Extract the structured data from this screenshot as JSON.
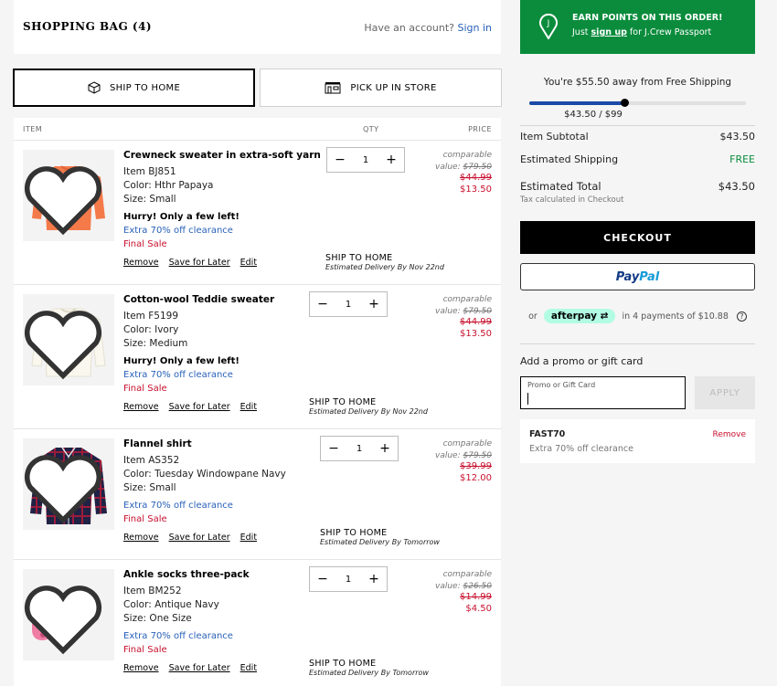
{
  "header": {
    "title": "SHOPPING BAG (4)",
    "account_prompt": "Have an account?",
    "sign_in": "Sign in"
  },
  "fulfillment": {
    "ship_to_home": "SHIP TO HOME",
    "pick_up_in_store": "PICK UP IN STORE",
    "selected": "ship_to_home"
  },
  "columns": {
    "item": "ITEM",
    "qty": "QTY",
    "price": "PRICE"
  },
  "items": [
    {
      "name": "Crewneck sweater in extra-soft yarn",
      "item_no": "Item BJ851",
      "color": "Color: Hthr Papaya",
      "size": "Size: Small",
      "hurry": "Hurry! Only a few left!",
      "promo": "Extra 70% off clearance",
      "final_sale": "Final Sale",
      "qty": "1",
      "comparable_label": "comparable",
      "comparable_value_label": "value:",
      "comparable_value": "$79.50",
      "was_price": "$44.99",
      "price": "$13.50",
      "ship_method": "SHIP TO HOME",
      "delivery": "Estimated Delivery By Nov 22nd",
      "image_color": "#f47a4a"
    },
    {
      "name": "Cotton-wool Teddie sweater",
      "item_no": "Item F5199",
      "color": "Color: Ivory",
      "size": "Size: Medium",
      "hurry": "Hurry! Only a few left!",
      "promo": "Extra 70% off clearance",
      "final_sale": "Final Sale",
      "qty": "1",
      "comparable_label": "comparable",
      "comparable_value_label": "value:",
      "comparable_value": "$79.50",
      "was_price": "$44.99",
      "price": "$13.50",
      "ship_method": "SHIP TO HOME",
      "delivery": "Estimated Delivery By Nov 22nd",
      "image_color": "#f7f4ea"
    },
    {
      "name": "Flannel shirt",
      "item_no": "Item AS352",
      "color": "Color: Tuesday Windowpane Navy",
      "size": "Size: Small",
      "promo": "Extra 70% off clearance",
      "final_sale": "Final Sale",
      "qty": "1",
      "comparable_label": "comparable",
      "comparable_value_label": "value:",
      "comparable_value": "$79.50",
      "was_price": "$39.99",
      "price": "$12.00",
      "ship_method": "SHIP TO HOME",
      "delivery": "Estimated Delivery By Tomorrow",
      "image_color": "#1f2245"
    },
    {
      "name": "Ankle socks three-pack",
      "item_no": "Item BM252",
      "color": "Color: Antique Navy",
      "size": "Size: One Size",
      "promo": "Extra 70% off clearance",
      "final_sale": "Final Sale",
      "qty": "1",
      "comparable_label": "comparable",
      "comparable_value_label": "value:",
      "comparable_value": "$26.50",
      "was_price": "$14.99",
      "price": "$4.50",
      "ship_method": "SHIP TO HOME",
      "delivery": "Estimated Delivery By Tomorrow",
      "image_color": "#ef7ca3"
    }
  ],
  "item_actions": {
    "remove": "Remove",
    "save_for_later": "Save for Later",
    "edit": "Edit"
  },
  "rewards": {
    "title": "EARN POINTS ON THIS ORDER!",
    "just": "Just",
    "sign_up": "sign up",
    "suffix": "for J.Crew Passport"
  },
  "free_shipping": {
    "message": "You're $55.50 away from Free Shipping",
    "progress_label": "$43.50 / $99",
    "progress": 0.44
  },
  "summary": {
    "subtotal_label": "Item Subtotal",
    "subtotal": "$43.50",
    "shipping_label": "Estimated Shipping",
    "shipping": "FREE",
    "total_label": "Estimated Total",
    "total": "$43.50",
    "tax_note": "Tax calculated in Checkout"
  },
  "checkout": {
    "label": "CHECKOUT"
  },
  "paypal": {
    "pay": "Pay",
    "pal": "Pal"
  },
  "afterpay": {
    "or": "or",
    "brand": "afterpay",
    "text": "in 4 payments of $10.88",
    "help": "?"
  },
  "promo": {
    "title": "Add a promo or gift card",
    "placeholder": "Promo or Gift Card",
    "apply": "APPLY",
    "applied_code": "FAST70",
    "applied_desc": "Extra 70% off clearance",
    "remove": "Remove"
  }
}
